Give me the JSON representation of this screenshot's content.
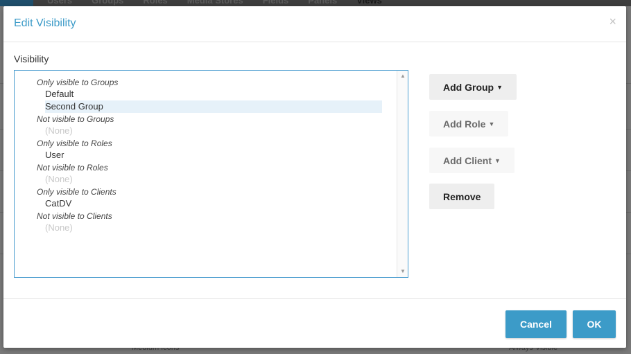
{
  "background": {
    "tabs": [
      "Users",
      "Groups",
      "Roles",
      "Media Stores",
      "Fields",
      "Panels",
      "Views"
    ],
    "active_tab": "Views",
    "bottom_texts": [
      "Medium Icons",
      "Always Visible"
    ]
  },
  "dialog": {
    "title": "Edit Visibility",
    "close_symbol": "×",
    "field_label": "Visibility",
    "visibility_list": [
      {
        "heading": "Only visible to Groups",
        "items": [
          {
            "label": "Default",
            "selected": false
          },
          {
            "label": "Second Group",
            "selected": true
          }
        ]
      },
      {
        "heading": "Not visible to Groups",
        "items": [
          {
            "label": "(None)",
            "none": true
          }
        ]
      },
      {
        "heading": "Only visible to Roles",
        "items": [
          {
            "label": "User"
          }
        ]
      },
      {
        "heading": "Not visible to Roles",
        "items": [
          {
            "label": "(None)",
            "none": true
          }
        ]
      },
      {
        "heading": "Only visible to Clients",
        "items": [
          {
            "label": "CatDV"
          }
        ]
      },
      {
        "heading": "Not visible to Clients",
        "items": [
          {
            "label": "(None)",
            "none": true
          }
        ]
      }
    ],
    "buttons": {
      "add_group": "Add Group",
      "add_role": "Add Role",
      "add_client": "Add Client",
      "remove": "Remove",
      "cancel": "Cancel",
      "ok": "OK"
    },
    "icons": {
      "caret": "caret-down-icon",
      "scroll_up": "scroll-up-arrow-icon",
      "scroll_down": "scroll-down-arrow-icon"
    },
    "colors": {
      "accent": "#3c9bc8",
      "selection": "#e6f1f9",
      "box_border": "#4d9ed0"
    }
  }
}
